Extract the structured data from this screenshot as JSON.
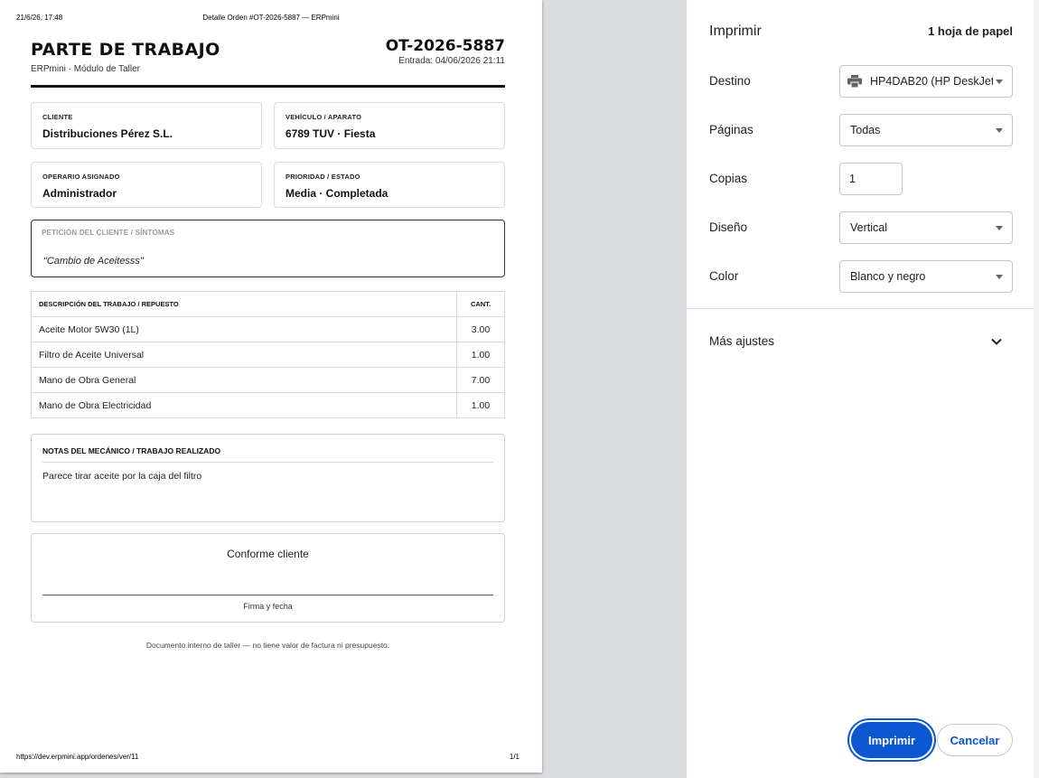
{
  "browser_header": {
    "datetime": "21/6/26, 17:48",
    "page_title": "Detalle Orden #OT-2026-5887 — ERPmini"
  },
  "browser_footer": {
    "url": "https://dev.erpmini.app/ordenes/ver/11",
    "page_count": "1/1"
  },
  "document": {
    "title": "PARTE DE TRABAJO",
    "subtitle": "ERPmini · Módulo de Taller",
    "order_number": "OT-2026-5887",
    "entry_date": "Entrada: 04/06/2026 21:11",
    "client": {
      "label": "CLIENTE",
      "value": "Distribuciones Pérez S.L."
    },
    "vehicle": {
      "label": "VEHÍCULO / APARATO",
      "value": "6789 TUV · Fiesta"
    },
    "operator": {
      "label": "OPERARIO ASIGNADO",
      "value": "Administrador"
    },
    "priority": {
      "label": "PRIORIDAD / ESTADO",
      "value": "Media · Completada"
    },
    "request": {
      "label": "PETICIÓN DEL CLIENTE / SÍNTOMAS",
      "text": "\"Cambio de Aceitesss\""
    },
    "items_table": {
      "headers": {
        "description": "DESCRIPCIÓN DEL TRABAJO / REPUESTO",
        "quantity": "CANT."
      },
      "rows": [
        {
          "description": "Aceite Motor 5W30 (1L)",
          "quantity": "3.00"
        },
        {
          "description": "Filtro de Aceite Universal",
          "quantity": "1.00"
        },
        {
          "description": "Mano de Obra General",
          "quantity": "7.00"
        },
        {
          "description": "Mano de Obra Electricidad",
          "quantity": "1.00"
        }
      ]
    },
    "notes": {
      "label": "NOTAS DEL MECÁNICO / TRABAJO REALIZADO",
      "text": "Parece tirar aceite por la caja del filtro"
    },
    "signature": {
      "title": "Conforme cliente",
      "caption": "Firma y fecha"
    },
    "disclaimer": "Documento interno de taller — no tiene valor de factura ni presupuesto."
  },
  "print_panel": {
    "title": "Imprimir",
    "sheets": "1 hoja de papel",
    "destination": {
      "label": "Destino",
      "value": "HP4DAB20 (HP DeskJet",
      "icon": "printer-icon"
    },
    "pages": {
      "label": "Páginas",
      "value": "Todas"
    },
    "copies": {
      "label": "Copias",
      "value": "1"
    },
    "layout": {
      "label": "Diseño",
      "value": "Vertical"
    },
    "color": {
      "label": "Color",
      "value": "Blanco y negro"
    },
    "more_settings": "Más ajustes",
    "print_button": "Imprimir",
    "cancel_button": "Cancelar",
    "accent_color": "#0b57d0"
  }
}
